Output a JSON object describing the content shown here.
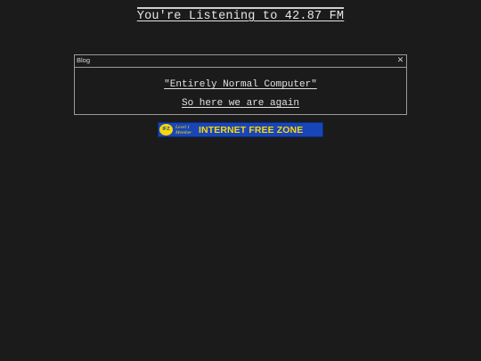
{
  "header": {
    "title": "You're Listening to 42.87 FM"
  },
  "window": {
    "title": "Blog",
    "close_symbol": "✕",
    "posts": [
      {
        "label": "\"Entirely Normal Computer\""
      },
      {
        "label": "So here we are again"
      }
    ]
  },
  "badge": {
    "logo_text": "IFZ",
    "level_line1": "Level 1",
    "level_line2": "Member",
    "text": "INTERNET FREE ZONE",
    "colors": {
      "background": "#1846b8",
      "foreground": "#ffd800"
    },
    "icon": "ifz-logo-icon"
  },
  "colors": {
    "background": "#1b1b1c",
    "text": "#d8d8d8",
    "border": "#9a9a9a"
  }
}
